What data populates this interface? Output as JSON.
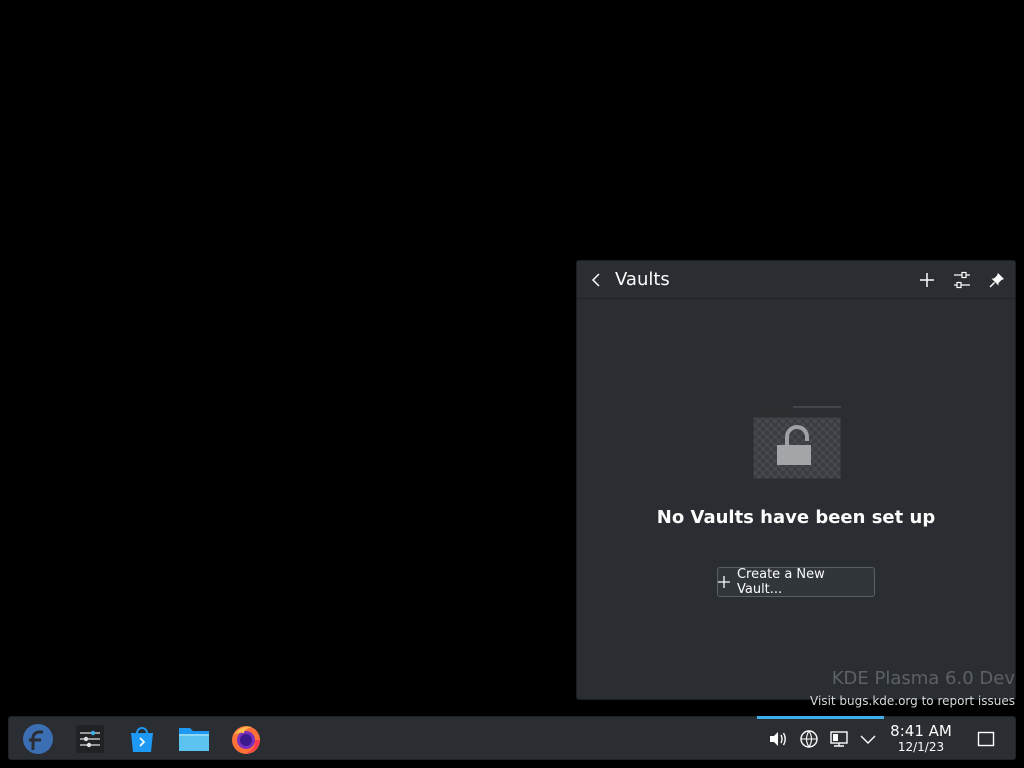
{
  "popup": {
    "title": "Vaults",
    "empty_message": "No Vaults have been set up",
    "create_button_label": "Create a New Vault..."
  },
  "watermark": {
    "title": "KDE Plasma 6.0 Dev",
    "subtitle": "Visit bugs.kde.org to report issues"
  },
  "taskbar": {
    "apps": [
      {
        "icon": "fedora-launcher-icon"
      },
      {
        "icon": "system-settings-icon"
      },
      {
        "icon": "discover-store-icon"
      },
      {
        "icon": "file-manager-icon"
      },
      {
        "icon": "firefox-icon"
      }
    ],
    "tray": {
      "icons": [
        "volume-icon",
        "network-icon",
        "display-icon",
        "expand-tray-icon"
      ],
      "time": "8:41 AM",
      "date": "12/1/23"
    }
  },
  "colors": {
    "accent": "#3daee9",
    "popup_bg": "#2a2e32",
    "desktop_bg": "#000000"
  }
}
